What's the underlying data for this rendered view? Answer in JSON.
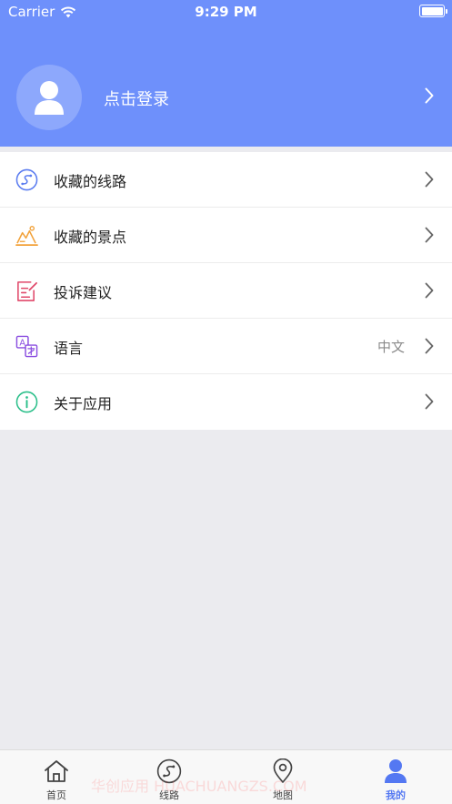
{
  "status_bar": {
    "carrier": "Carrier",
    "time": "9:29 PM"
  },
  "profile": {
    "login_label": "点击登录"
  },
  "menu": {
    "items": [
      {
        "label": "收藏的线路",
        "icon": "route-icon",
        "color": "#5b7cf0"
      },
      {
        "label": "收藏的景点",
        "icon": "scenic-spot-icon",
        "color": "#f2a23a"
      },
      {
        "label": "投诉建议",
        "icon": "feedback-edit-icon",
        "color": "#e0486a"
      },
      {
        "label": "语言",
        "value": "中文",
        "icon": "language-icon",
        "color": "#8a4ee0"
      },
      {
        "label": "关于应用",
        "icon": "info-icon",
        "color": "#2bbf8a"
      }
    ]
  },
  "tabbar": {
    "tabs": [
      {
        "label": "首页",
        "icon": "home-icon"
      },
      {
        "label": "线路",
        "icon": "route-icon"
      },
      {
        "label": "地图",
        "icon": "map-pin-icon"
      },
      {
        "label": "我的",
        "icon": "user-icon",
        "active": true
      }
    ]
  },
  "watermark": "华创应用 HUACHUANGZS.COM",
  "colors": {
    "header": "#6e90fb",
    "active_tab": "#5478f2"
  }
}
